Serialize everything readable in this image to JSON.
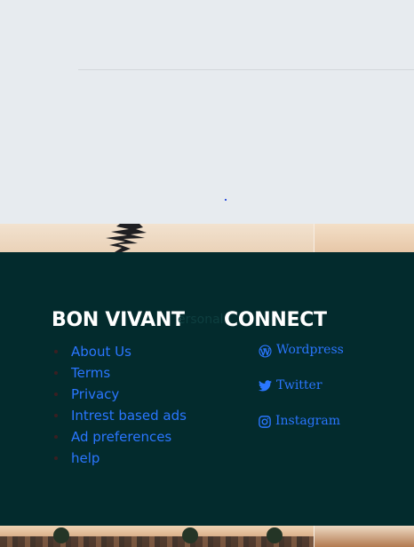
{
  "footer": {
    "brand_title": "BON VIVANT",
    "brand_ghost_text": "ersonal",
    "links": [
      {
        "label": "About Us"
      },
      {
        "label": "Terms"
      },
      {
        "label": "Privacy"
      },
      {
        "label": "Intrest based ads"
      },
      {
        "label": "Ad preferences"
      },
      {
        "label": "help"
      }
    ],
    "connect_title": "CONNECT",
    "social": [
      {
        "label": "Wordpress",
        "icon": "wordpress-icon"
      },
      {
        "label": "Twitter",
        "icon": "twitter-icon"
      },
      {
        "label": "Instagram",
        "icon": "instagram-icon"
      }
    ]
  },
  "colors": {
    "page_background": "#e7ebef",
    "footer_background": "#032b2d",
    "link": "#2a76ff",
    "heading": "#ffffff"
  }
}
